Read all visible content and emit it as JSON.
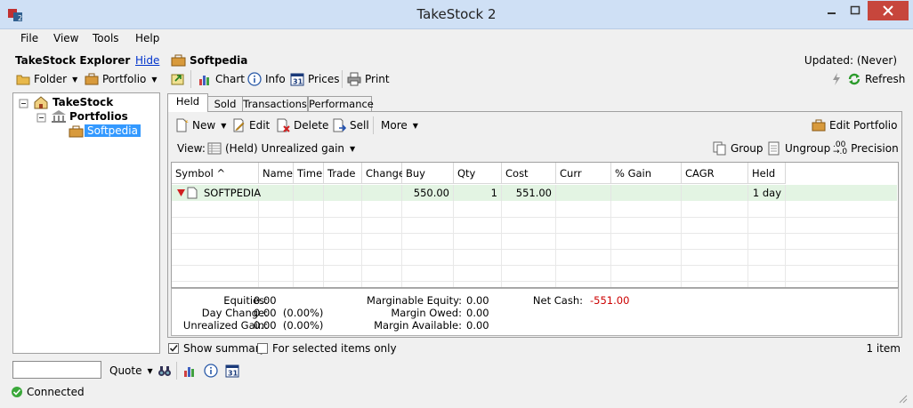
{
  "window": {
    "title": "TakeStock 2"
  },
  "menu": [
    "File",
    "View",
    "Tools",
    "Help"
  ],
  "explorer": {
    "title": "TakeStock Explorer",
    "hide_link": "Hide",
    "folder_btn": "Folder",
    "portfolio_btn": "Portfolio",
    "tree": {
      "root": "TakeStock",
      "portfolios": "Portfolios",
      "selected": "Softpedia"
    }
  },
  "portfolio": {
    "name": "Softpedia",
    "updated": "Updated: (Never)",
    "toolbar": {
      "chart": "Chart",
      "info": "Info",
      "prices": "Prices",
      "print": "Print",
      "refresh": "Refresh"
    }
  },
  "tabs": [
    "Held",
    "Sold",
    "Transactions",
    "Performance"
  ],
  "actions": {
    "new": "New",
    "edit": "Edit",
    "delete": "Delete",
    "sell": "Sell",
    "more": "More",
    "edit_portfolio": "Edit Portfolio"
  },
  "view": {
    "label": "View:",
    "selected": "(Held) Unrealized gain",
    "group": "Group",
    "ungroup": "Ungroup",
    "precision": "Precision"
  },
  "table": {
    "columns": [
      "Symbol ^",
      "Name",
      "Time",
      "Trade",
      "Change",
      "Buy Price",
      "Qty Held",
      "Cost Basis",
      "Curr Value",
      "% Gain (+Div)",
      "CAGR (+Div)",
      "Held"
    ],
    "rows": [
      {
        "symbol": "SOFTPEDIA",
        "name": "",
        "time": "",
        "trade": "",
        "change": "",
        "buy_price": "550.00",
        "qty_held": "1",
        "cost_basis": "551.00",
        "curr_value": "",
        "gain": "",
        "cagr": "",
        "held": "1 day"
      }
    ]
  },
  "summary": {
    "equities_label": "Equities:",
    "equities": "0.00",
    "day_change_label": "Day Change:",
    "day_change": "0.00  (0.00%)",
    "unrealized_label": "Unrealized Gain:",
    "unrealized": "0.00  (0.00%)",
    "marginable_label": "Marginable Equity:",
    "marginable": "0.00",
    "margin_owed_label": "Margin Owed:",
    "margin_owed": "0.00",
    "margin_avail_label": "Margin Available:",
    "margin_avail": "0.00",
    "net_cash_label": "Net Cash:",
    "net_cash": "-551.00",
    "negative_color": "#cc0000"
  },
  "options": {
    "show_summary": "Show summary",
    "selected_only": "For selected items only",
    "count": "1 item"
  },
  "bottom": {
    "quote_btn": "Quote",
    "search_value": ""
  },
  "status": {
    "text": "Connected"
  }
}
